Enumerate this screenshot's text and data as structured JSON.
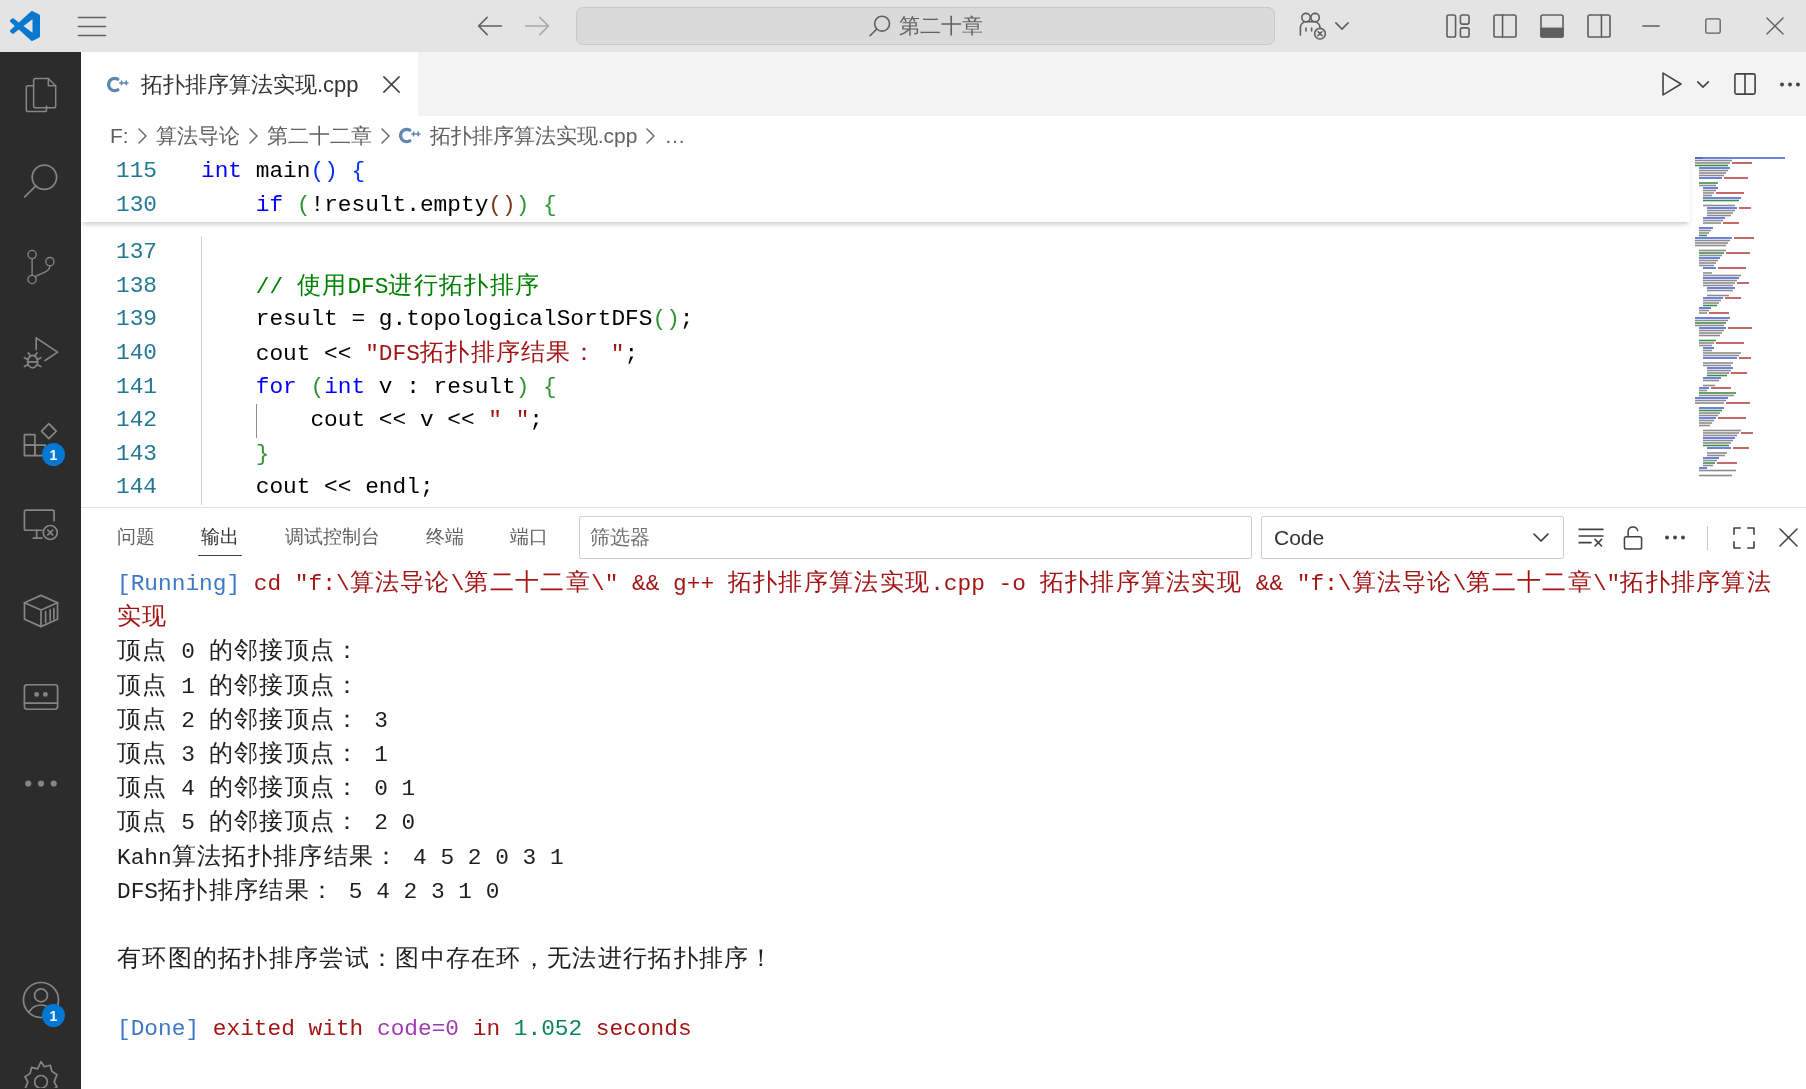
{
  "title_bar": {
    "nav": [
      {
        "kind": "back",
        "disabled": false
      },
      {
        "kind": "forward",
        "disabled": true
      }
    ],
    "search_text": "第二十章",
    "layout_toggles": [
      {
        "kind": "sidebar-left",
        "on": false
      },
      {
        "kind": "panel",
        "on": true
      },
      {
        "kind": "sidebar-right",
        "on": false
      }
    ]
  },
  "activity_bar": {
    "items": [
      {
        "kind": "explorer",
        "selected": false
      },
      {
        "kind": "search",
        "selected": false
      },
      {
        "kind": "source-control",
        "selected": false
      },
      {
        "kind": "run-debug",
        "selected": false
      },
      {
        "kind": "extensions",
        "selected": false,
        "badge": "1"
      },
      {
        "kind": "remote",
        "selected": false
      },
      {
        "kind": "containers",
        "selected": false
      },
      {
        "kind": "screen",
        "selected": false
      }
    ],
    "account": {
      "badge": "1"
    }
  },
  "editor": {
    "tabs": [
      {
        "label": "拓扑排序算法实现.cpp",
        "selected": true
      }
    ],
    "breadcrumbs": [
      {
        "kind": "folder",
        "label": "F:"
      },
      {
        "kind": "folder",
        "label": "算法导论"
      },
      {
        "kind": "folder",
        "label": "第二十二章"
      },
      {
        "kind": "file",
        "label": "拓扑排序算法实现.cpp"
      },
      {
        "kind": "symbol",
        "label": "…"
      }
    ],
    "sticky_scroll": [
      {
        "number": "115",
        "tokens": [
          {
            "text": "int",
            "kind": "keyword"
          },
          {
            "text": " main",
            "kind": "plain"
          },
          {
            "text": "()",
            "kind": "bracket-1"
          },
          {
            "text": " {",
            "kind": "bracket-1"
          }
        ]
      },
      {
        "number": "130",
        "tokens": [
          {
            "text": "    if",
            "kind": "keyword"
          },
          {
            "text": " (",
            "kind": "bracket-2"
          },
          {
            "text": "!result.empty",
            "kind": "plain"
          },
          {
            "text": "()",
            "kind": "bracket-3"
          },
          {
            "text": ")",
            "kind": "bracket-2"
          },
          {
            "text": " {",
            "kind": "bracket-2"
          }
        ]
      }
    ],
    "lines": [
      {
        "number": "137"
      },
      {
        "number": "138",
        "tokens": [
          {
            "text": "    // 使用DFS进行拓扑排序",
            "kind": "comment"
          }
        ]
      },
      {
        "number": "139",
        "tokens": [
          {
            "text": "    result = g.topologicalSortDFS",
            "kind": "plain"
          },
          {
            "text": "()",
            "kind": "bracket-2"
          },
          {
            "text": ";",
            "kind": "plain"
          }
        ]
      },
      {
        "number": "140",
        "tokens": [
          {
            "text": "    cout << ",
            "kind": "plain"
          },
          {
            "text": "\"DFS拓扑排序结果： \"",
            "kind": "string"
          },
          {
            "text": ";",
            "kind": "plain"
          }
        ]
      },
      {
        "number": "141",
        "tokens": [
          {
            "text": "    for",
            "kind": "keyword"
          },
          {
            "text": " (",
            "kind": "bracket-2"
          },
          {
            "text": "int",
            "kind": "keyword"
          },
          {
            "text": " v : result",
            "kind": "plain"
          },
          {
            "text": ")",
            "kind": "bracket-2"
          },
          {
            "text": " {",
            "kind": "bracket-2"
          }
        ]
      },
      {
        "number": "142",
        "tokens": [
          {
            "text": "        cout << v << ",
            "kind": "plain"
          },
          {
            "text": "\" \"",
            "kind": "string"
          },
          {
            "text": ";",
            "kind": "plain"
          }
        ]
      },
      {
        "number": "143",
        "tokens": [
          {
            "text": "    }",
            "kind": "bracket-2"
          }
        ]
      },
      {
        "number": "144",
        "tokens": [
          {
            "text": "    cout << endl;",
            "kind": "plain"
          }
        ]
      }
    ]
  },
  "panel": {
    "tabs": [
      {
        "label": "问题",
        "selected": false
      },
      {
        "label": "输出",
        "selected": true
      },
      {
        "label": "调试控制台",
        "selected": false
      },
      {
        "label": "终端",
        "selected": false
      },
      {
        "label": "端口",
        "selected": false
      }
    ],
    "filter": {
      "placeholder": "筛选器"
    },
    "channel": {
      "value": "Code"
    },
    "output": [
      {
        "kind": "text",
        "segments": [
          {
            "text": "[Running]",
            "kind": "status"
          },
          {
            "text": " cd \"f:\\算法导论\\第二十二章\\\" && g++ 拓扑排序算法实现.cpp -o 拓扑排序算法实现 && \"f:\\算法导论\\第二十二章\\\"拓扑排序算法实现",
            "kind": "message"
          }
        ]
      },
      {
        "kind": "text",
        "segments": [
          {
            "text": "顶点 0 的邻接顶点：",
            "kind": "plain"
          }
        ]
      },
      {
        "kind": "text",
        "segments": [
          {
            "text": "顶点 1 的邻接顶点：",
            "kind": "plain"
          }
        ]
      },
      {
        "kind": "text",
        "segments": [
          {
            "text": "顶点 2 的邻接顶点： 3",
            "kind": "plain"
          }
        ]
      },
      {
        "kind": "text",
        "segments": [
          {
            "text": "顶点 3 的邻接顶点： 1",
            "kind": "plain"
          }
        ]
      },
      {
        "kind": "text",
        "segments": [
          {
            "text": "顶点 4 的邻接顶点： 0 1",
            "kind": "plain"
          }
        ]
      },
      {
        "kind": "text",
        "segments": [
          {
            "text": "顶点 5 的邻接顶点： 2 0",
            "kind": "plain"
          }
        ]
      },
      {
        "kind": "text",
        "segments": [
          {
            "text": "Kahn算法拓扑排序结果： 4 5 2 0 3 1",
            "kind": "plain"
          }
        ]
      },
      {
        "kind": "text",
        "segments": [
          {
            "text": "DFS拓扑排序结果： 5 4 2 3 1 0",
            "kind": "plain"
          }
        ]
      },
      {
        "kind": "blank"
      },
      {
        "kind": "text",
        "segments": [
          {
            "text": "有环图的拓扑排序尝试：图中存在环，无法进行拓扑排序！",
            "kind": "plain"
          }
        ]
      },
      {
        "kind": "blank"
      },
      {
        "kind": "text",
        "segments": [
          {
            "text": "[Done]",
            "kind": "status"
          },
          {
            "text": " exited with ",
            "kind": "message"
          },
          {
            "text": "code=0",
            "kind": "code"
          },
          {
            "text": " in ",
            "kind": "message"
          },
          {
            "text": "1.052",
            "kind": "number"
          },
          {
            "text": " seconds",
            "kind": "message"
          }
        ]
      }
    ]
  }
}
